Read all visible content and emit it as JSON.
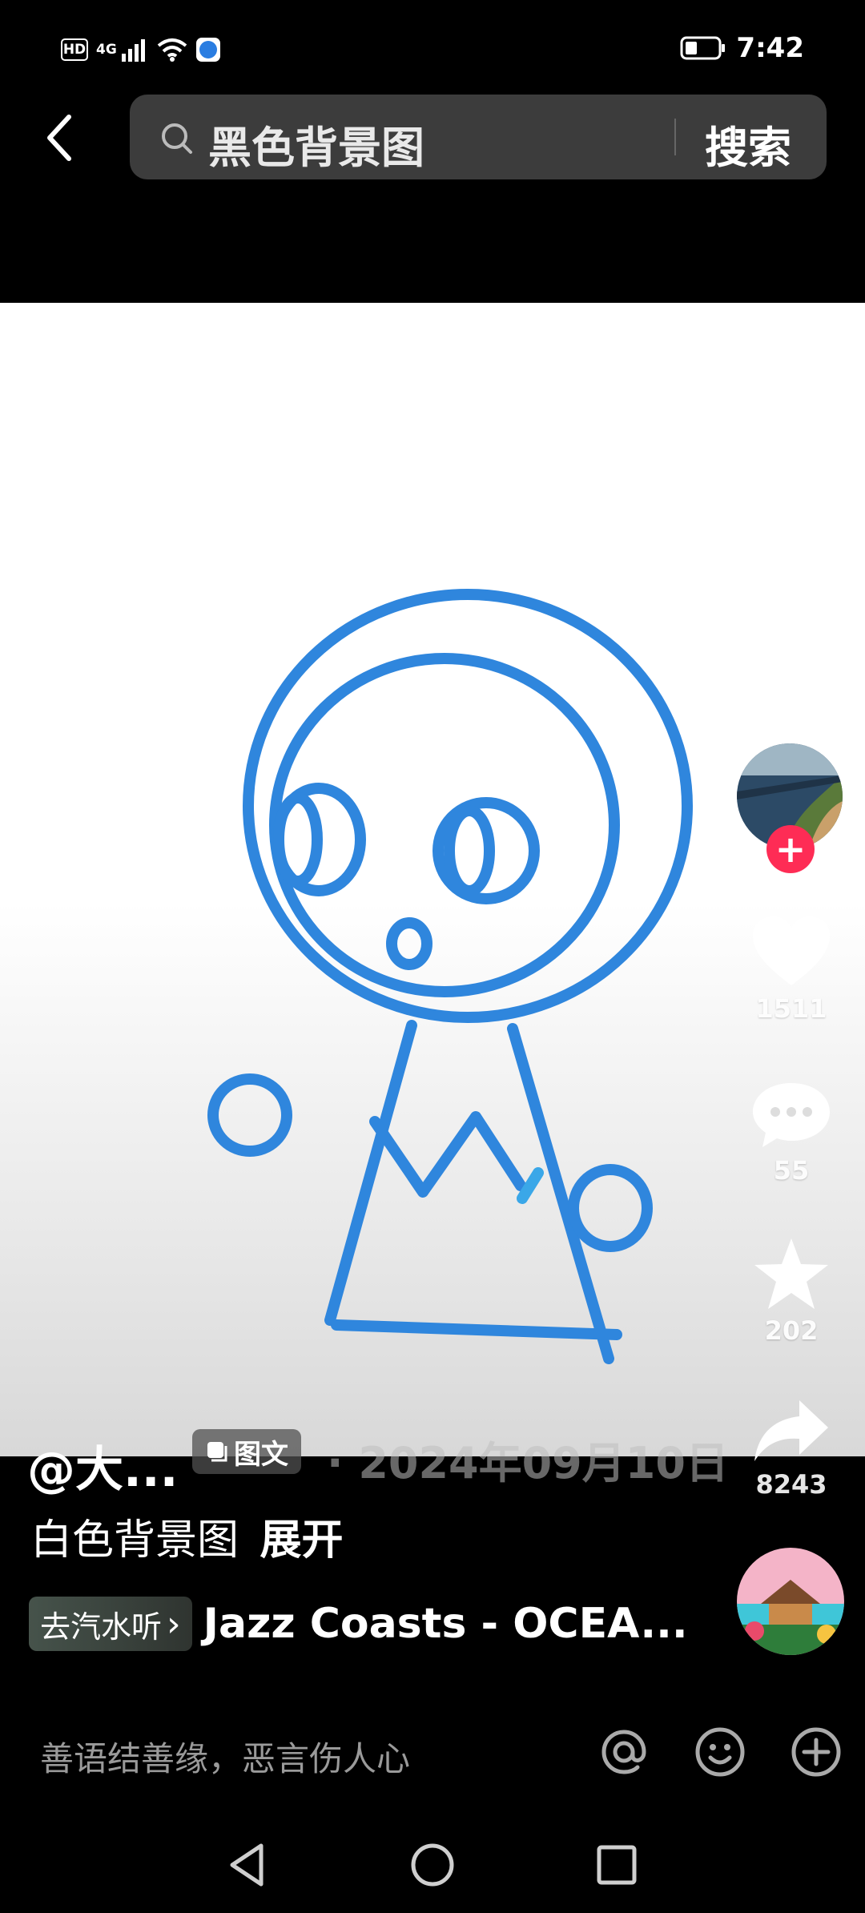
{
  "status_bar": {
    "hd": "HD",
    "network": "4G",
    "time": "7:42"
  },
  "search": {
    "query": "黑色背景图",
    "button_label": "搜索"
  },
  "post": {
    "author": "@大...",
    "type_badge": "图文",
    "date": "· 2024年09月10日",
    "caption": "白色背景图",
    "expand_label": "展开"
  },
  "music": {
    "chip_label": "去汽水听",
    "chip_chevron": "›",
    "title": "Jazz Coasts - OCEA..."
  },
  "actions": {
    "follow_glyph": "+",
    "likes": "1511",
    "comments": "55",
    "favorites": "202",
    "shares": "8243"
  },
  "comment_bar": {
    "placeholder": "善语结善缘，恶言伤人心"
  },
  "icons": [
    "hd-icon",
    "signal-icon",
    "wifi-icon",
    "app-icon",
    "battery-icon",
    "back-icon",
    "search-icon",
    "heart-icon",
    "comment-icon",
    "star-icon",
    "share-icon",
    "at-icon",
    "emoji-icon",
    "plus-icon",
    "nav-back-icon",
    "nav-home-icon",
    "nav-recents-icon"
  ],
  "colors": {
    "accent_pink": "#fe2c55",
    "drawing_blue": "#2f86dd",
    "background": "#000000"
  }
}
